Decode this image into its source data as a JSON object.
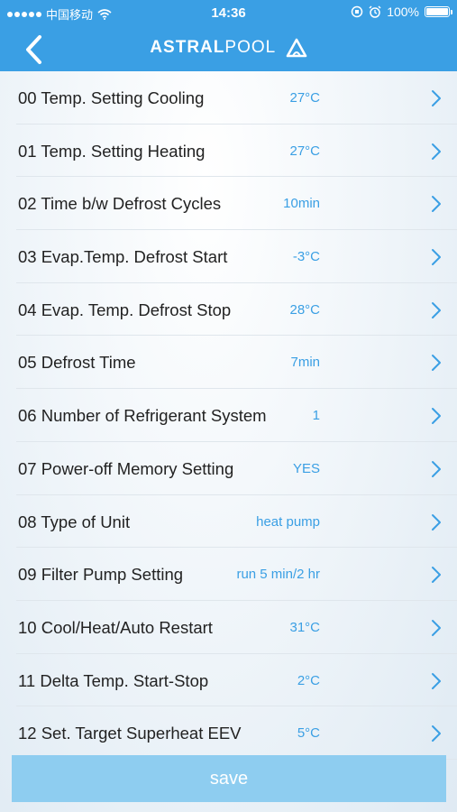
{
  "status_bar": {
    "carrier": "中国移动",
    "time": "14:36",
    "battery": "100%",
    "icons": [
      "signal-dots-icon",
      "wifi-icon",
      "location-lock-icon",
      "alarm-icon",
      "battery-icon"
    ]
  },
  "nav": {
    "back_icon": "chevron-left-icon",
    "logo_bold": "ASTRAL",
    "logo_light": "POOL"
  },
  "settings": [
    {
      "label": "00 Temp. Setting Cooling",
      "value": "27°C"
    },
    {
      "label": "01 Temp. Setting Heating",
      "value": "27°C"
    },
    {
      "label": "02 Time b/w Defrost Cycles",
      "value": "10min"
    },
    {
      "label": "03 Evap.Temp. Defrost Start",
      "value": "-3°C"
    },
    {
      "label": "04 Evap. Temp. Defrost Stop",
      "value": "28°C"
    },
    {
      "label": "05 Defrost Time",
      "value": "7min"
    },
    {
      "label": "06 Number of Refrigerant System",
      "value": "1"
    },
    {
      "label": "07 Power-off Memory Setting",
      "value": "YES"
    },
    {
      "label": "08 Type of Unit",
      "value": "heat pump"
    },
    {
      "label": "09 Filter Pump Setting",
      "value": "run 5 min/2 hr"
    },
    {
      "label": "10 Cool/Heat/Auto Restart",
      "value": "31°C"
    },
    {
      "label": "11 Delta Temp. Start-Stop",
      "value": "2°C"
    },
    {
      "label": "12 Set. Target Superheat EEV",
      "value": "5°C"
    }
  ],
  "save_label": "save",
  "colors": {
    "accent": "#3a9fe4",
    "save_button": "#8ecdf0"
  }
}
